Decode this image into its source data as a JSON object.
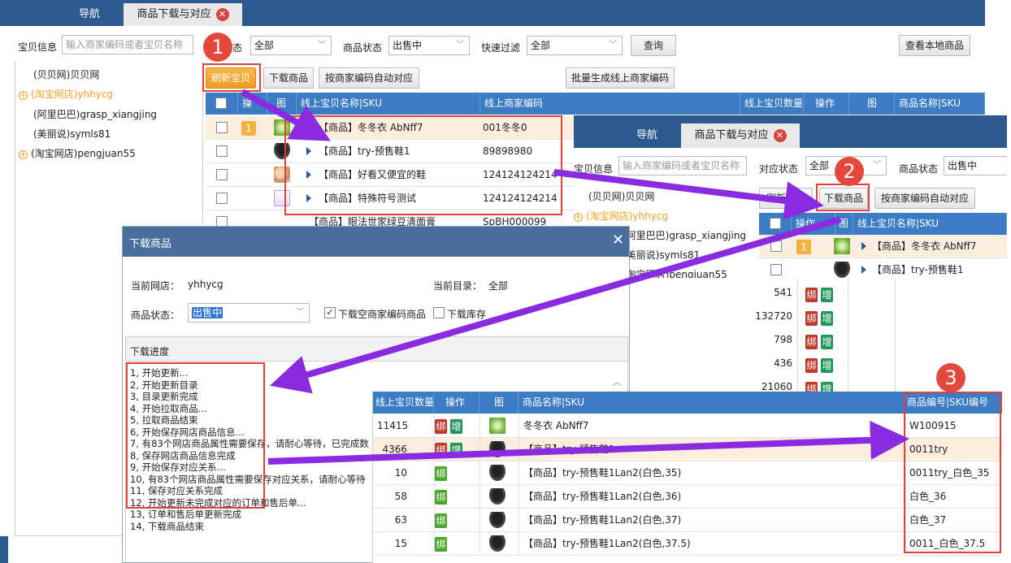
{
  "win1": {
    "tabs": [
      "导航",
      "商品下载与对应"
    ],
    "baobei_label": "宝贝信息",
    "baobei_placeholder": "输入商家编码或者宝贝名称",
    "status_label_partial": "态",
    "status_value": "全部",
    "product_status_label": "商品状态",
    "product_status_value": "出售中",
    "filter_label": "快速过滤",
    "filter_value": "全部",
    "query": "查询",
    "view_local": "查看本地商品",
    "buttons": [
      "刷新宝贝",
      "下载商品",
      "按商家编码自动对应",
      "批量生成线上商家编码"
    ],
    "sidebar": [
      "(贝贝网)贝贝网",
      "(淘宝网店)yhhycg",
      "(阿里巴巴)grasp_xiangjing",
      "(美丽说)symls81",
      "(淘宝网店)pengjuan55"
    ],
    "headers": [
      "操",
      "图",
      "线上宝贝名称|SKU",
      "线上商家编码",
      "线上宝贝数量",
      "操作",
      "图",
      "商品名称|SKU"
    ],
    "rows": [
      {
        "badge": "1",
        "name": "【商品】冬冬衣 AbNff7",
        "code": "001冬冬0"
      },
      {
        "badge": "",
        "name": "【商品】try-预售鞋1",
        "code": "89898980"
      },
      {
        "badge": "",
        "name": "【商品】好看又便宜的鞋",
        "code": "124124124214"
      },
      {
        "badge": "",
        "name": "【商品】特殊符号测试",
        "code": "124124124214"
      },
      {
        "badge": "",
        "name": "【商品】眼法世家绿豆清面膏",
        "code": "SpBH000099"
      }
    ]
  },
  "win2": {
    "tabs": [
      "导航",
      "商品下载与对应"
    ],
    "baobei_label": "宝贝信息",
    "baobei_placeholder": "输入商家编码或者宝贝名称",
    "match_label": "对应状态",
    "match_value": "全部",
    "product_status_label": "商品状态",
    "product_status_value": "出售中",
    "buttons": [
      "刷新宝贝",
      "下载商品",
      "按商家编码自动对应"
    ],
    "sidebar": [
      "(贝贝网)贝贝网",
      "(淘宝网店)yhhycg",
      "(阿里巴巴)grasp_xiangjing",
      "(美丽说)symls81",
      "(淘宝网店)pengjuan55"
    ],
    "headers": [
      "操作",
      "图",
      "线上宝贝名称|SKU"
    ],
    "rows": [
      {
        "badge": "1",
        "name": "【商品】冬冬衣 AbNff7"
      },
      {
        "badge": "",
        "name": "【商品】try-预售鞋1"
      }
    ],
    "qty": [
      "541",
      "132720",
      "798",
      "436",
      "21060"
    ],
    "ops": [
      "绑",
      "增"
    ]
  },
  "dialog": {
    "title": "下载商品",
    "shop_label": "当前网店：",
    "shop_value": "yhhycg",
    "dir_label": "当前目录：",
    "dir_value": "全部",
    "status_label": "商品状态：",
    "status_value": "出售中",
    "chk1": "下载空商家编码商品",
    "chk2": "下载库存",
    "progress_title": "下载进度",
    "progress": [
      "1, 开始更新...",
      "2, 开始更新目录",
      "3, 目录更新完成",
      "4, 开始拉取商品...",
      "5, 拉取商品结束",
      "6, 开始保存网店商品信息...",
      "7, 有83个网店商品属性需要保存，请耐心等待，已完成数",
      "8, 保存网店商品信息完成",
      "9, 开始保存对应关系...",
      "10, 有83个网店商品属性需要保存对应关系，请耐心等待",
      "11, 保存对应关系完成",
      "12, 开始更新未完成对应的订单和售后单...",
      "13, 订单和售后单更新完成",
      "14, 下载商品结束"
    ]
  },
  "win3": {
    "headers": [
      "线上宝贝数量",
      "操作",
      "图",
      "商品名称|SKU",
      "商品编号|SKU编号"
    ],
    "rows": [
      {
        "qty": "11415",
        "ops": [
          "绑",
          "增"
        ],
        "name": "冬冬衣 AbNff7",
        "code": "W100915"
      },
      {
        "qty": "4366",
        "ops": [
          "绑",
          "增"
        ],
        "name": "【商品】try-预售鞋1",
        "code": "0011try"
      },
      {
        "qty": "10",
        "ops": [
          "绑"
        ],
        "name": "【商品】try-预售鞋1Lan2(白色,35)",
        "code": "0011try_白色_35"
      },
      {
        "qty": "58",
        "ops": [
          "绑"
        ],
        "name": "【商品】try-预售鞋1Lan2(白色,36)",
        "code": "白色_36"
      },
      {
        "qty": "63",
        "ops": [
          "绑"
        ],
        "name": "【商品】try-预售鞋1Lan2(白色,37)",
        "code": "白色_37"
      },
      {
        "qty": "15",
        "ops": [
          "绑"
        ],
        "name": "【商品】try-预售鞋1Lan2(白色,37.5)",
        "code": "0011_白色_37.5"
      }
    ]
  },
  "steps": [
    "1",
    "2",
    "3"
  ],
  "colors": {
    "header_blue": "#3b7cc4",
    "tab_bar": "#2c5a8e",
    "annotation_red": "#e0413a",
    "arrow_purple": "#8a2be2",
    "refresh_orange": "#f09a1e"
  }
}
